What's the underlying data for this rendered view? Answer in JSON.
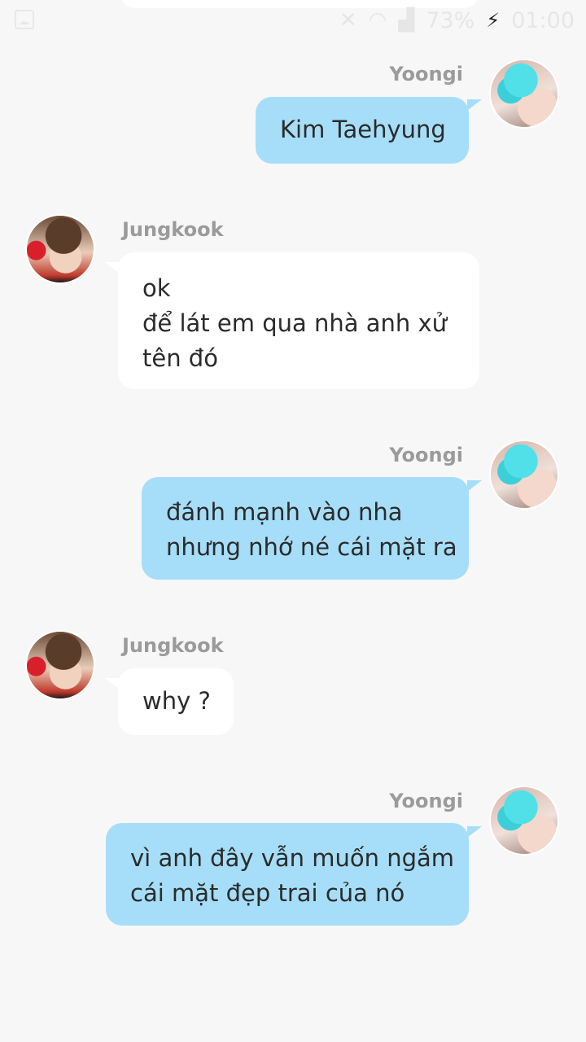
{
  "status_bar": {
    "battery": "73%",
    "time": "01:00",
    "icons": [
      "gallery-icon",
      "mute-icon",
      "wifi-icon",
      "signal-icon",
      "charging-icon"
    ]
  },
  "messages": [
    {
      "sender": "Yoongi",
      "side": "right",
      "lines": [
        "Kim Taehyung"
      ]
    },
    {
      "sender": "Jungkook",
      "side": "left",
      "lines": [
        "ok",
        "để lát em qua nhà anh xử",
        "tên đó"
      ]
    },
    {
      "sender": "Yoongi",
      "side": "right",
      "lines": [
        "đánh mạnh vào nha",
        "nhưng nhớ né cái mặt ra"
      ]
    },
    {
      "sender": "Jungkook",
      "side": "left",
      "lines": [
        "why ?"
      ]
    },
    {
      "sender": "Yoongi",
      "side": "right",
      "lines": [
        "vì anh đây vẫn muốn ngắm",
        "cái mặt đẹp trai của nó"
      ]
    }
  ],
  "colors": {
    "background": "#f7f7f7",
    "right_bubble": "#a6def9",
    "left_bubble": "#ffffff",
    "name_text": "#9b9b9b"
  }
}
